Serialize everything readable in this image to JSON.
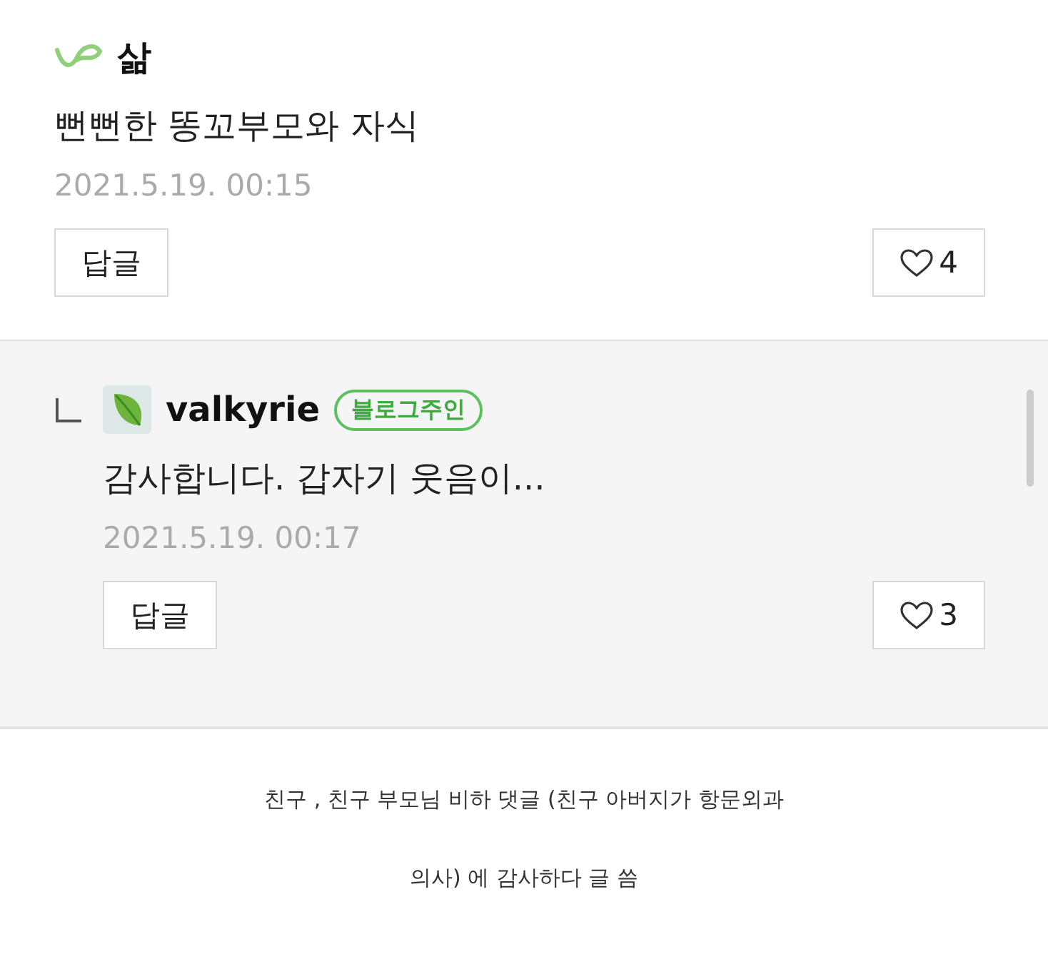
{
  "comments": [
    {
      "kind": "comment",
      "author": "삶",
      "body": "뻔뻔한 똥꼬부모와 자식",
      "date": "2021.5.19. 00:15",
      "reply_button": "답글",
      "likes": "4"
    },
    {
      "kind": "reply",
      "author": "valkyrie",
      "badge": "블로그주인",
      "body": "감사합니다. 갑자기 웃음이...",
      "date": "2021.5.19. 00:17",
      "reply_button": "답글",
      "likes": "3"
    }
  ],
  "caption_lines": [
    "친구 , 친구 부모님 비하 댓글 (친구 아버지가 항문외과",
    "의사) 에 감사하다 글 씀"
  ]
}
